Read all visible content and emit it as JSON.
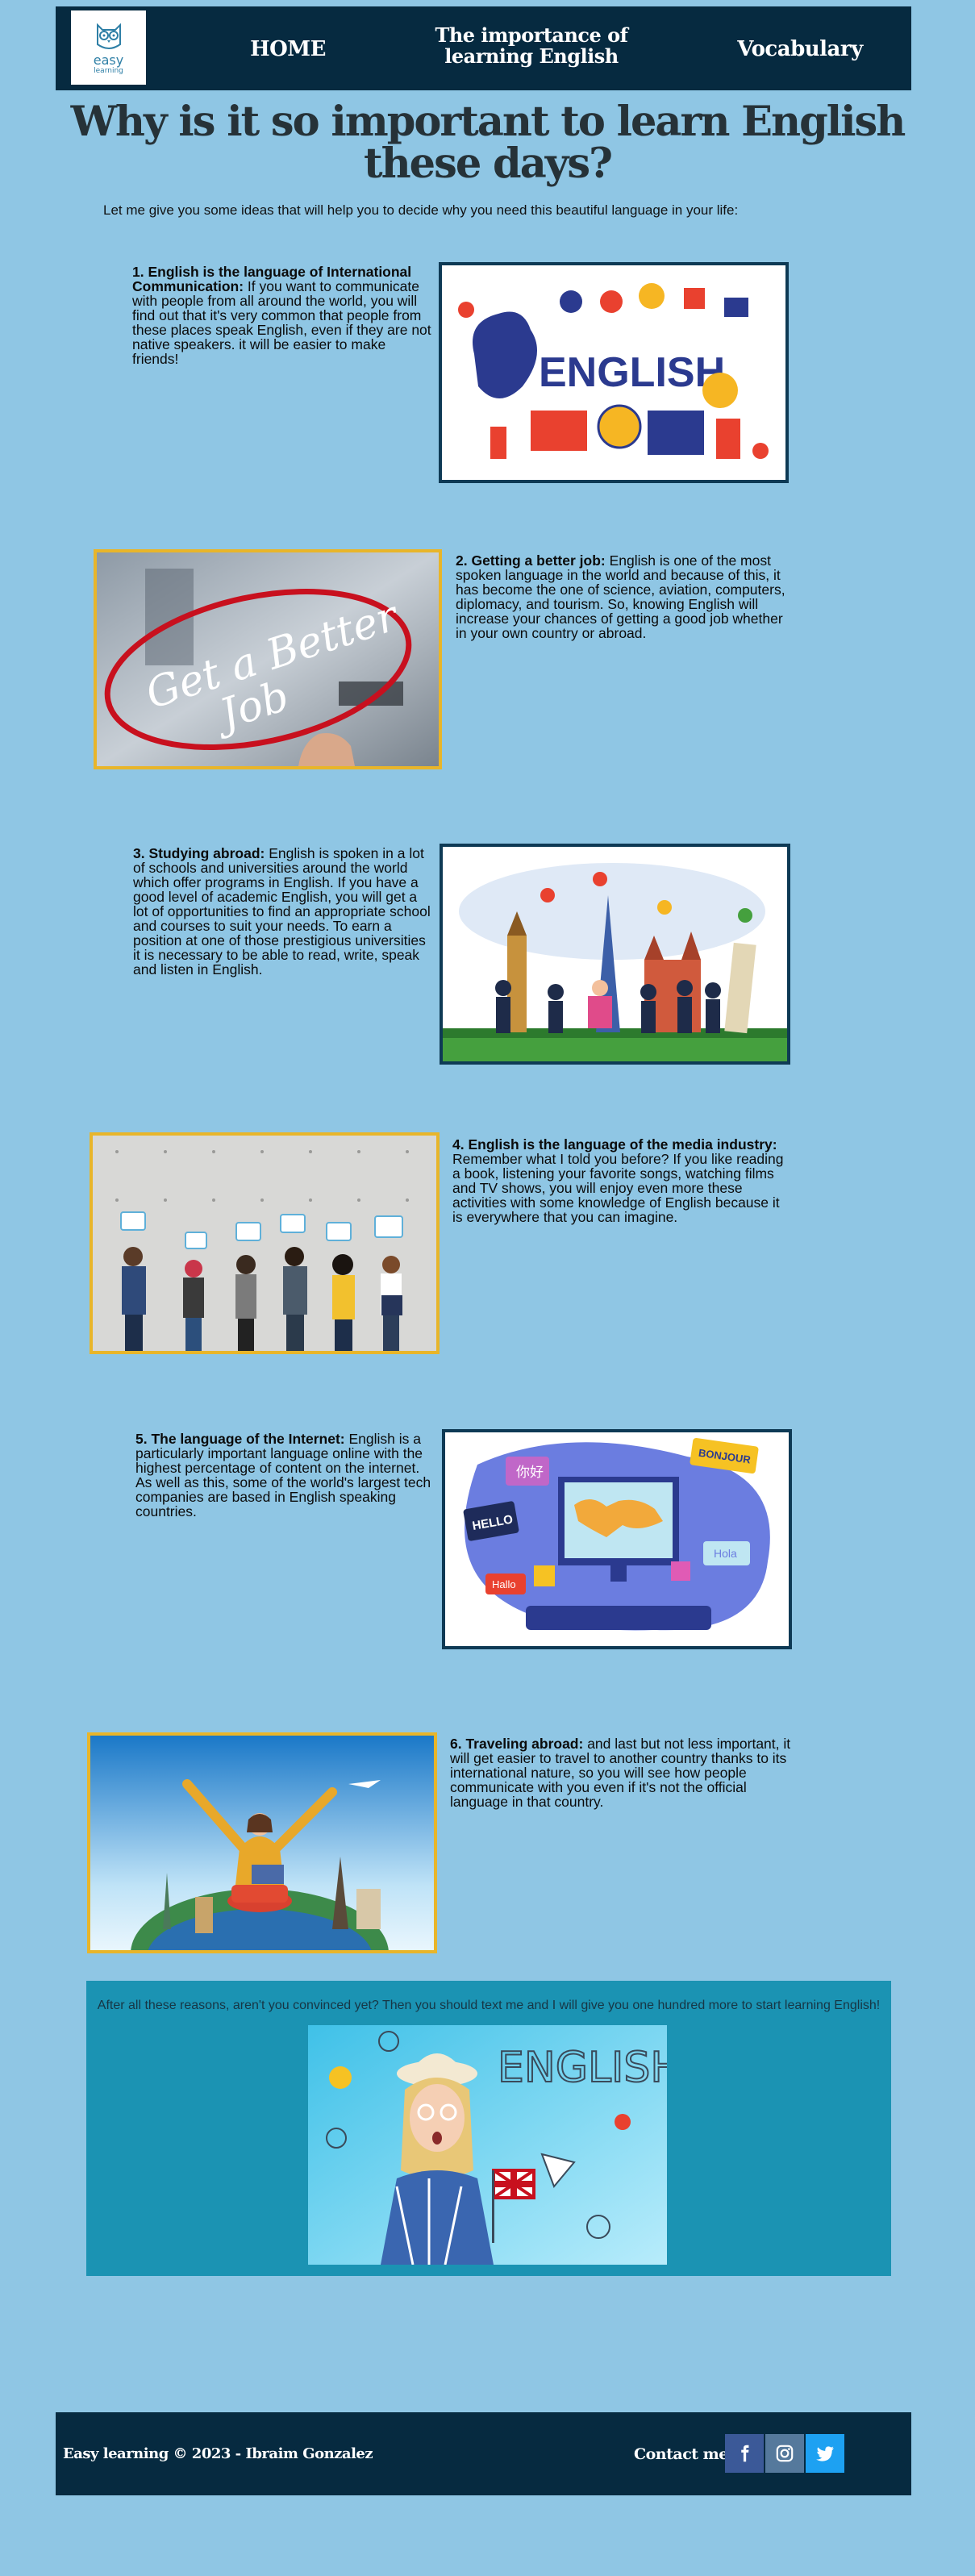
{
  "header": {
    "logo_text": "easy",
    "logo_subtext": "learning",
    "nav": {
      "home": "HOME",
      "importance_line1": "The importance of",
      "importance_line2": "learning English",
      "vocabulary": "Vocabulary"
    }
  },
  "page": {
    "title_line1": "Why is it so important to learn English",
    "title_line2": "these days?",
    "intro": "Let me give you some ideas that will help you to decide why you need this beautiful language in your life:"
  },
  "sections": [
    {
      "heading": "1. English is the language of International Communication:",
      "body": " If you want to communicate with people from all around the world, you will find out that it's very common that people from these places speak English, even if they are not native speakers. it will be easier to make friends!",
      "image_label": "ENGLISH"
    },
    {
      "heading": "2. Getting a better job:",
      "body": " English is one of the most spoken language in the world and because of this, it has become the one of science, aviation, computers, diplomacy, and tourism. So, knowing English will increase your chances of getting a good job whether in your own country or abroad.",
      "image_label_1": "Get a Better",
      "image_label_2": "Job"
    },
    {
      "heading": "3. Studying abroad:",
      "body": " English is spoken in a lot of schools and universities around the world which offer programs in English. If you have a good level of academic English, you will get a lot of opportunities to find an appropriate school and courses to suit your needs. To earn a position at one of those prestigious universities it is necessary to be able to read, write, speak and listen in English."
    },
    {
      "heading": "4. English is the language of the media industry:",
      "body": " Remember what I told you before? If you like reading a book, listening your favorite songs, watching films and TV shows, you will enjoy even more these activities with some knowledge of English because it is everywhere that you can imagine."
    },
    {
      "heading": "5. The language of the Internet:",
      "body": " English is a particularly important language online with the highest percentage of content on the internet. As well as this, some of the world's largest tech companies are based in English speaking countries.",
      "bubble_1": "你好",
      "bubble_2": "BONJOUR",
      "bubble_3": "HELLO",
      "bubble_4": "Hola",
      "bubble_5": "Hallo"
    },
    {
      "heading": "6. Traveling abroad:",
      "body": " and last but not less important, it will get easier to travel to another country thanks to its international nature, so you will see how people communicate with you even if it's not the official language in that country."
    }
  ],
  "closing": {
    "text": "After all these reasons, aren't you convinced yet? Then you should text me and I will give you one hundred more to start learning English!",
    "image_label": "ENGLISH"
  },
  "footer": {
    "copyright": "Easy learning © 2023 - Ibraim Gonzalez",
    "contact": "Contact me"
  },
  "colors": {
    "background": "#8fc6e4",
    "header_bg": "#062a40",
    "closing_bg": "#1b93b3",
    "frame_navy": "#0e3a55",
    "frame_gold": "#e8b52a"
  }
}
